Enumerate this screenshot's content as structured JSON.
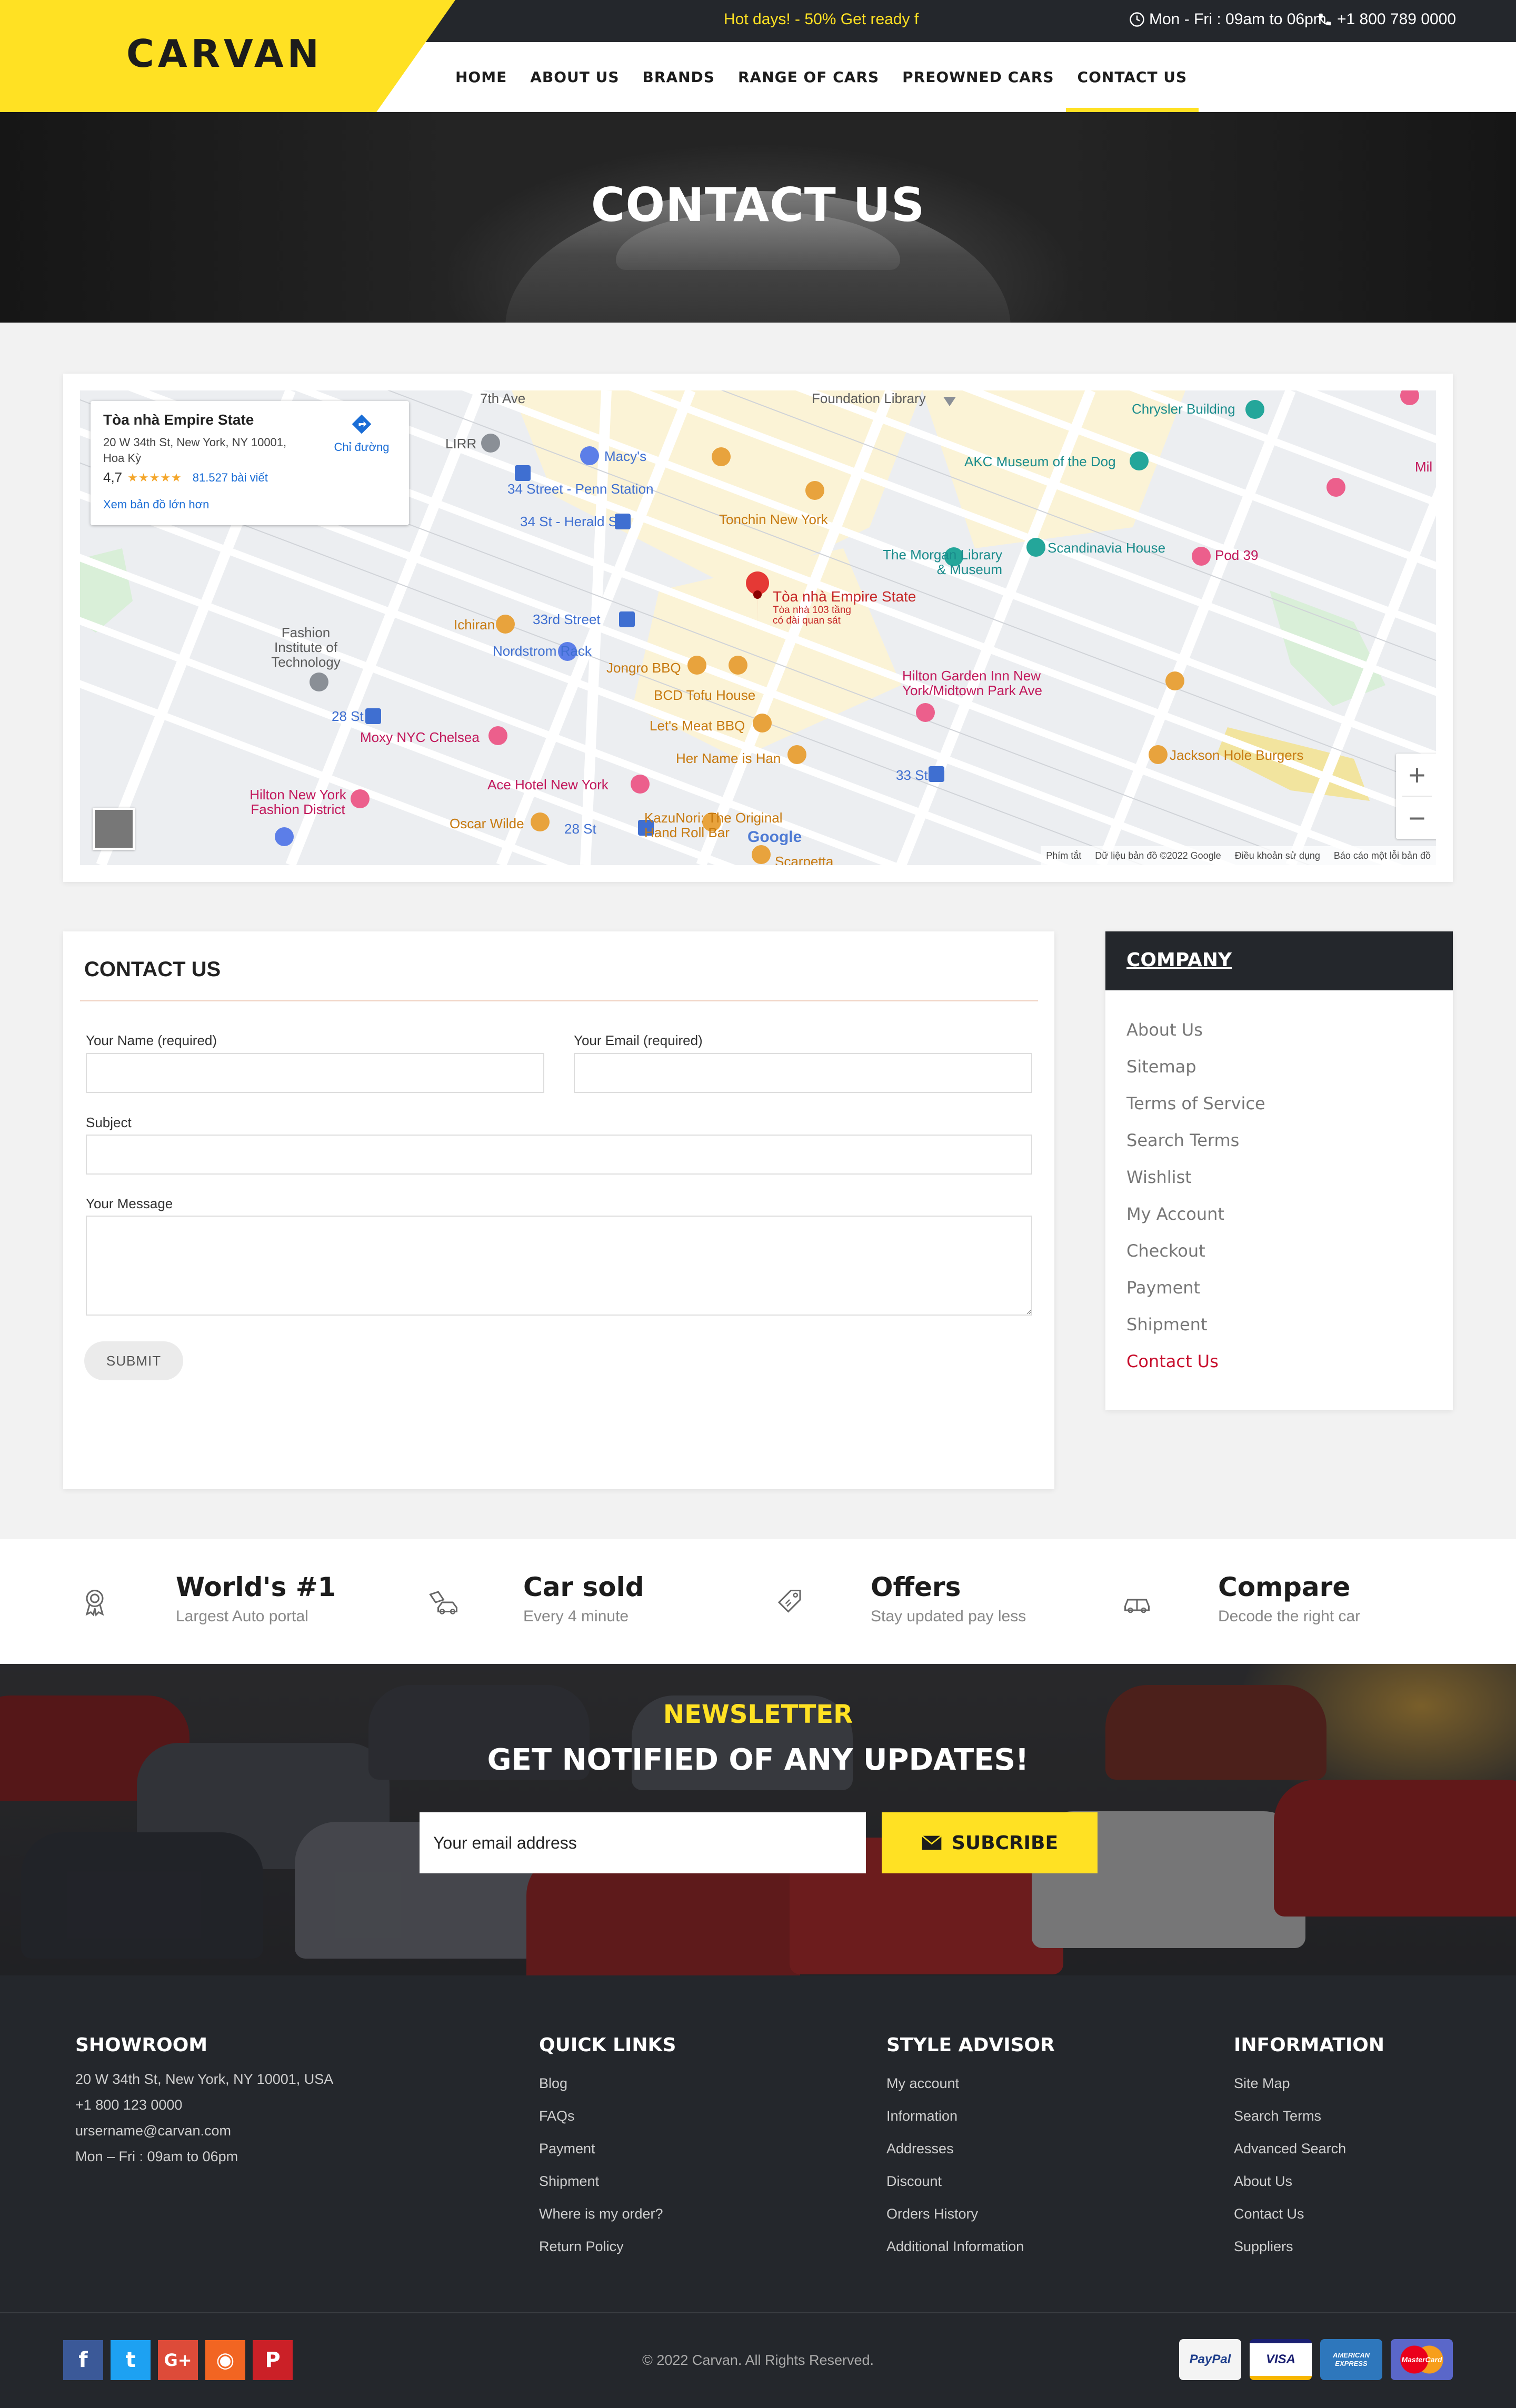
{
  "header": {
    "logo": "CARVAN",
    "hot_deal": "Hot days! - 50% Get ready f",
    "hours": "Mon - Fri : 09am to 06pm",
    "phone": "+1 800 789 0000",
    "nav": [
      {
        "label": "HOME"
      },
      {
        "label": "ABOUT US"
      },
      {
        "label": "BRANDS"
      },
      {
        "label": "RANGE OF CARS"
      },
      {
        "label": "PREOWNED CARS"
      },
      {
        "label": "CONTACT US",
        "active": true
      }
    ]
  },
  "hero": {
    "title": "CONTACT US"
  },
  "map": {
    "info": {
      "title": "Tòa nhà Empire State",
      "address": "20 W 34th St, New York, NY 10001, Hoa Kỳ",
      "rating": "4,7",
      "stars": "★★★★★",
      "reviews": "81.527 bài viết",
      "larger_map": "Xem bản đồ lớn hơn",
      "directions": "Chỉ đường"
    },
    "pin_title": "Tòa nhà Empire State",
    "pin_sub": "Tòa nhà 103 tầng có đài quan sát",
    "labels": {
      "foundation_library": "Foundation Library",
      "chrysler": "Chrysler Building",
      "macys": "Macy's",
      "lirr": "LIRR",
      "penn_34": "34 Street - Penn Station",
      "herald": "34 St - Herald Sq",
      "tonchin": "Tonchin New York",
      "akc": "AKC Museum of the Dog",
      "morgan": "The Morgan Library & Museum",
      "scandinavia": "Scandinavia House",
      "pod39": "Pod 39",
      "fashion_inst": "Fashion Institute of Technology",
      "ichiran": "Ichiran",
      "street_33rd": "33rd Street",
      "nordstrom": "Nordstrom Rack",
      "jongro": "Jongro BBQ",
      "bcd": "BCD Tofu House",
      "letsmeat": "Let's Meat BBQ",
      "hername": "Her Name is Han",
      "hilton_garden": "Hilton Garden Inn New York/Midtown Park Ave",
      "st28": "28 St",
      "moxy": "Moxy NYC Chelsea",
      "ace": "Ace Hotel New York",
      "hilton_fashion": "Hilton New York Fashion District",
      "oscar": "Oscar Wilde",
      "kazunori": "KazuNori: The Original Hand Roll Bar",
      "st28b": "28 St",
      "st33": "33 St",
      "jackson": "Jackson Hole Burgers",
      "scarpetta": "Scarpetta",
      "ave7": "7th Ave",
      "mil": "Mil"
    },
    "footer": {
      "shortcuts": "Phím tắt",
      "data": "Dữ liệu bản đồ ©2022 Google",
      "terms": "Điều khoản sử dụng",
      "report": "Báo cáo một lỗi bản đồ"
    },
    "google": "Google",
    "zoom_in": "+",
    "zoom_out": "−"
  },
  "form": {
    "title": "CONTACT US",
    "name_label": "Your Name (required)",
    "email_label": "Your Email (required)",
    "subject_label": "Subject",
    "message_label": "Your Message",
    "submit": "SUBMIT"
  },
  "company": {
    "title": "COMPANY",
    "items": [
      {
        "label": "About Us"
      },
      {
        "label": "Sitemap"
      },
      {
        "label": "Terms of Service"
      },
      {
        "label": "Search Terms"
      },
      {
        "label": "Wishlist"
      },
      {
        "label": "My Account"
      },
      {
        "label": "Checkout"
      },
      {
        "label": "Payment"
      },
      {
        "label": "Shipment"
      },
      {
        "label": "Contact Us",
        "active": true
      }
    ]
  },
  "features": [
    {
      "title": "World's #1",
      "sub": "Largest Auto portal",
      "icon": "award-icon"
    },
    {
      "title": "Car sold",
      "sub": "Every 4 minute",
      "icon": "car-tag-icon"
    },
    {
      "title": "Offers",
      "sub": "Stay updated pay less",
      "icon": "price-tag-icon"
    },
    {
      "title": "Compare",
      "sub": "Decode the right car",
      "icon": "compare-car-icon"
    }
  ],
  "newsletter": {
    "kicker": "NEWSLETTER",
    "title": "GET NOTIFIED OF ANY UPDATES!",
    "placeholder": "Your email address",
    "button": "SUBCRIBE"
  },
  "footer": {
    "showroom": {
      "title": "SHOWROOM",
      "lines": [
        "20 W 34th St, New York, NY 10001, USA",
        "+1 800 123 0000",
        "ursername@carvan.com",
        "Mon – Fri : 09am to 06pm"
      ]
    },
    "quick_links": {
      "title": "QUICK LINKS",
      "items": [
        "Blog",
        "FAQs",
        "Payment",
        "Shipment",
        "Where is my order?",
        "Return Policy"
      ]
    },
    "style_advisor": {
      "title": "STYLE ADVISOR",
      "items": [
        "My account",
        "Information",
        "Addresses",
        "Discount",
        "Orders History",
        "Additional Information"
      ]
    },
    "information": {
      "title": "INFORMATION",
      "items": [
        "Site Map",
        "Search Terms",
        "Advanced Search",
        "About Us",
        "Contact Us",
        "Suppliers"
      ]
    },
    "socials": [
      {
        "name": "facebook-icon",
        "glyph": "f",
        "color": "#3b5998"
      },
      {
        "name": "twitter-icon",
        "glyph": "t",
        "color": "#1da1f2"
      },
      {
        "name": "google-plus-icon",
        "glyph": "G+",
        "color": "#dd4b39"
      },
      {
        "name": "rss-icon",
        "glyph": "◉",
        "color": "#f26522"
      },
      {
        "name": "pinterest-icon",
        "glyph": "P",
        "color": "#cb2027"
      }
    ],
    "copyright": "© 2022 Carvan. All Rights Reserved.",
    "payments": [
      {
        "name": "paypal-icon",
        "label": "PayPal"
      },
      {
        "name": "visa-icon",
        "label": "VISA"
      },
      {
        "name": "amex-icon",
        "label": "AMERICAN EXPRESS"
      },
      {
        "name": "mastercard-icon",
        "label": "MasterCard"
      }
    ]
  }
}
